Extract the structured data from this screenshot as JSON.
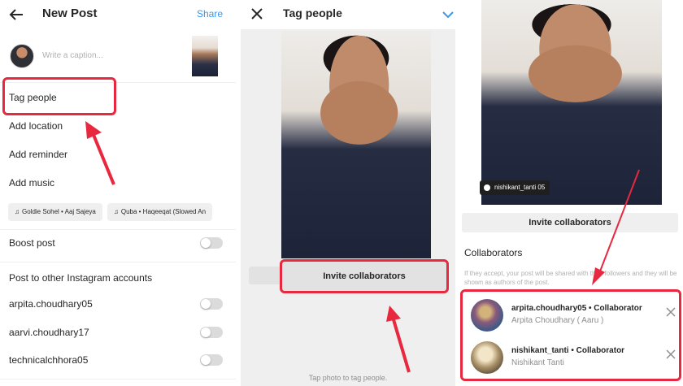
{
  "new_post": {
    "title": "New Post",
    "share": "Share",
    "caption_placeholder": "Write a caption...",
    "items": [
      "Tag people",
      "Add location",
      "Add reminder",
      "Add music"
    ],
    "music": [
      "Goldie Sohel • Aaj Sajeya",
      "Quba • Haqeeqat (Slowed An"
    ],
    "boost": "Boost post",
    "other_accounts_title": "Post to other Instagram accounts",
    "accounts": [
      "arpita.choudhary05",
      "aarvi.choudhary17",
      "technicalchhora05"
    ]
  },
  "tag_people": {
    "title": "Tag people",
    "invite": "Invite collaborators",
    "hint": "Tap photo to tag people."
  },
  "collab": {
    "tag_label": "nishikant_tanti 05",
    "invite": "Invite collaborators",
    "heading": "Collaborators",
    "desc": "If they accept, your post will be shared with their followers and they will be shown as authors of the post.",
    "people": [
      {
        "name": "arpita.choudhary05 • Collaborator",
        "sub": "Arpita Choudhary ( Aaru )"
      },
      {
        "name": "nishikant_tanti • Collaborator",
        "sub": "Nishikant Tanti"
      }
    ]
  },
  "colors": {
    "accent": "#3897f0",
    "highlight": "#e8283f"
  },
  "icons": [
    "back-arrow-icon",
    "close-icon",
    "check-icon",
    "music-note-icon",
    "remove-icon"
  ]
}
